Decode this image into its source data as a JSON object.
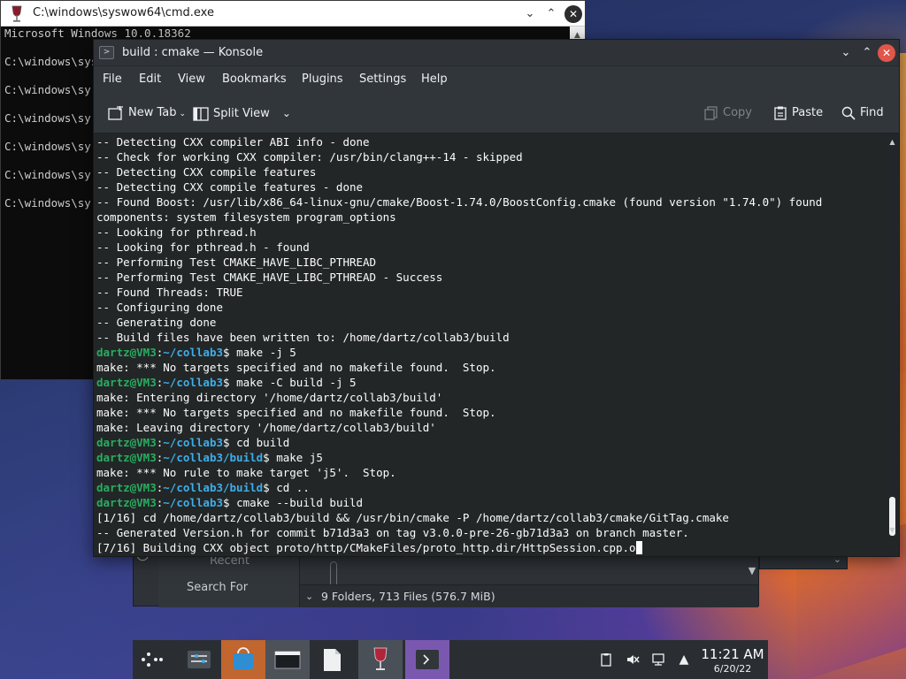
{
  "cmd_window": {
    "title": "C:\\windows\\syswow64\\cmd.exe",
    "lines": [
      "Microsoft Windows 10.0.18362",
      "",
      "C:\\windows\\sys",
      "",
      "C:\\windows\\sy",
      "",
      "C:\\windows\\sy",
      "",
      "C:\\windows\\sy",
      "",
      "C:\\windows\\sy",
      "",
      "C:\\windows\\sy"
    ]
  },
  "konsole": {
    "title": "build : cmake — Konsole",
    "menu": [
      "File",
      "Edit",
      "View",
      "Bookmarks",
      "Plugins",
      "Settings",
      "Help"
    ],
    "toolbar": {
      "new_tab": "New Tab",
      "split_view": "Split View",
      "copy": "Copy",
      "paste": "Paste",
      "find": "Find"
    },
    "prompt_user": "dartz@VM3",
    "terminal_lines": [
      {
        "type": "text",
        "text": "-- Detecting CXX compiler ABI info - done"
      },
      {
        "type": "text",
        "text": "-- Check for working CXX compiler: /usr/bin/clang++-14 - skipped"
      },
      {
        "type": "text",
        "text": "-- Detecting CXX compile features"
      },
      {
        "type": "text",
        "text": "-- Detecting CXX compile features - done"
      },
      {
        "type": "text",
        "text": "-- Found Boost: /usr/lib/x86_64-linux-gnu/cmake/Boost-1.74.0/BoostConfig.cmake (found version \"1.74.0\") found"
      },
      {
        "type": "text",
        "text": "components: system filesystem program_options"
      },
      {
        "type": "text",
        "text": "-- Looking for pthread.h"
      },
      {
        "type": "text",
        "text": "-- Looking for pthread.h - found"
      },
      {
        "type": "text",
        "text": "-- Performing Test CMAKE_HAVE_LIBC_PTHREAD"
      },
      {
        "type": "text",
        "text": "-- Performing Test CMAKE_HAVE_LIBC_PTHREAD - Success"
      },
      {
        "type": "text",
        "text": "-- Found Threads: TRUE"
      },
      {
        "type": "text",
        "text": "-- Configuring done"
      },
      {
        "type": "text",
        "text": "-- Generating done"
      },
      {
        "type": "text",
        "text": "-- Build files have been written to: /home/dartz/collab3/build"
      },
      {
        "type": "prompt",
        "path": "~/collab3",
        "cmd": "make -j 5"
      },
      {
        "type": "text",
        "text": "make: *** No targets specified and no makefile found.  Stop."
      },
      {
        "type": "prompt",
        "path": "~/collab3",
        "cmd": "make -C build -j 5"
      },
      {
        "type": "text",
        "text": "make: Entering directory '/home/dartz/collab3/build'"
      },
      {
        "type": "text",
        "text": "make: *** No targets specified and no makefile found.  Stop."
      },
      {
        "type": "text",
        "text": "make: Leaving directory '/home/dartz/collab3/build'"
      },
      {
        "type": "prompt",
        "path": "~/collab3",
        "cmd": "cd build"
      },
      {
        "type": "prompt",
        "path": "~/collab3/build",
        "cmd": "make j5"
      },
      {
        "type": "text",
        "text": "make: *** No rule to make target 'j5'.  Stop."
      },
      {
        "type": "prompt",
        "path": "~/collab3/build",
        "cmd": "cd .."
      },
      {
        "type": "prompt",
        "path": "~/collab3",
        "cmd": "cmake --build build"
      },
      {
        "type": "text",
        "text": "[1/16] cd /home/dartz/collab3/build && /usr/bin/cmake -P /home/dartz/collab3/cmake/GitTag.cmake"
      },
      {
        "type": "text",
        "text": "-- Generated Version.h for commit b71d3a3 on tag v3.0.0-pre-26-gb71d3a3 on branch master."
      },
      {
        "type": "text",
        "text": "[7/16] Building CXX object proto/http/CMakeFiles/proto_http.dir/HttpSession.cpp.o",
        "cursor": true
      }
    ]
  },
  "dolphin": {
    "recent_locations": "Recent Locations",
    "search_for": "Search For",
    "status": "9 Folders, 713 Files (576.7 MiB)"
  },
  "taskbar": {
    "clock_time": "11:21 AM",
    "clock_date": "6/20/22"
  },
  "colors": {
    "konsole_bg": "#232627",
    "prompt_user": "#27ae60",
    "prompt_path": "#3daee9",
    "close_button": "#e0564a",
    "taskbar": "#2a2e32"
  }
}
